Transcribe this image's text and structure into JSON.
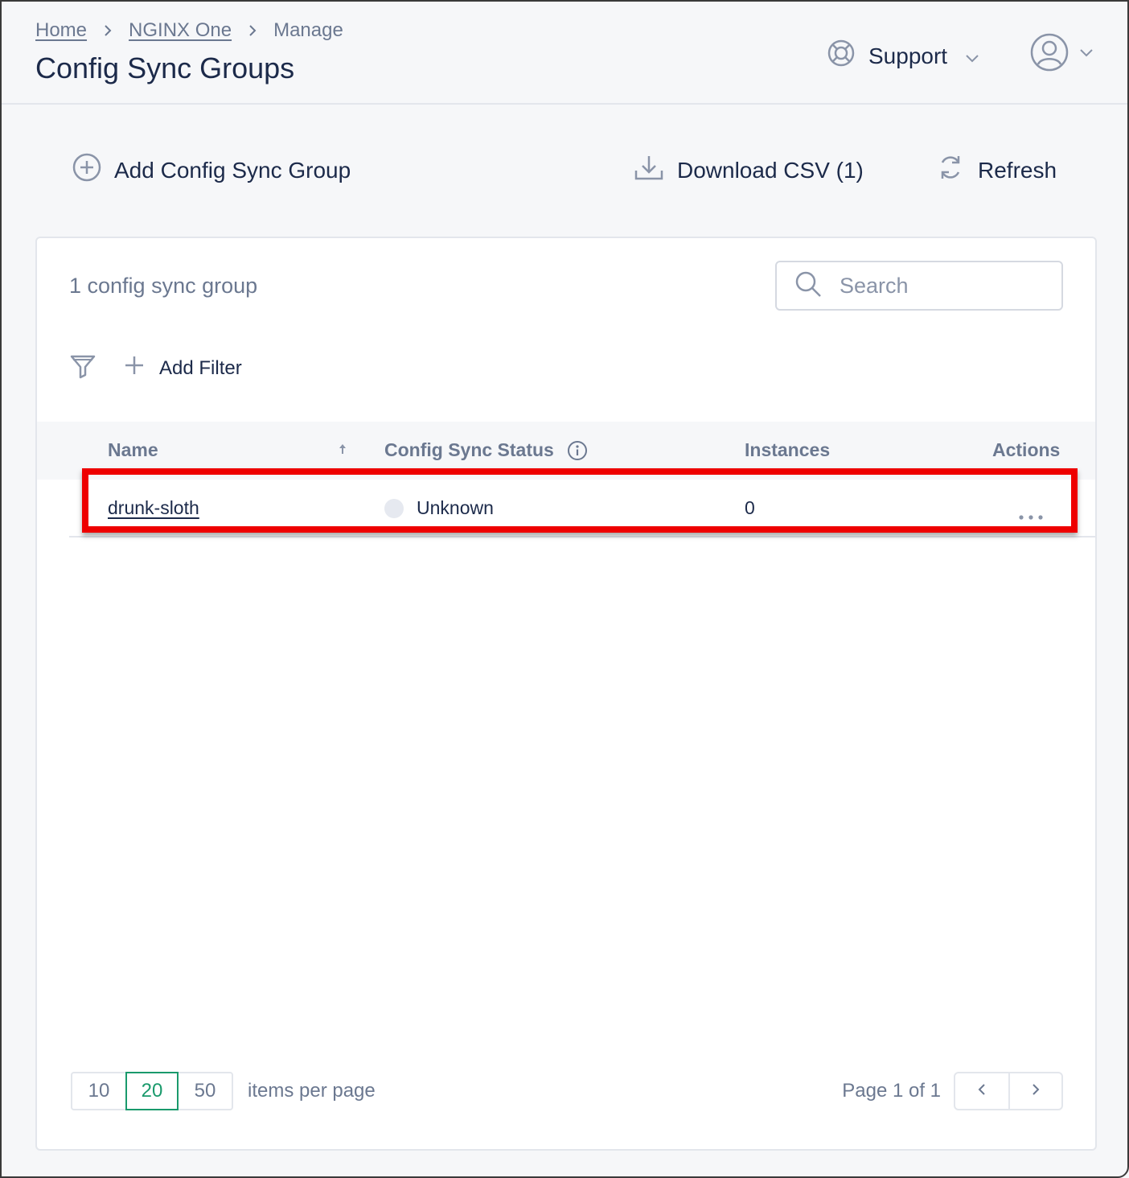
{
  "breadcrumb": {
    "items": [
      "Home",
      "NGINX One",
      "Manage"
    ]
  },
  "header": {
    "title": "Config Sync Groups",
    "support_label": "Support"
  },
  "toolbar": {
    "add_label": "Add Config Sync Group",
    "download_label": "Download CSV (1)",
    "refresh_label": "Refresh"
  },
  "list": {
    "count_text": "1 config sync group",
    "search_placeholder": "Search",
    "add_filter_label": "Add Filter",
    "columns": {
      "name": "Name",
      "status": "Config Sync Status",
      "instances": "Instances",
      "actions": "Actions"
    },
    "rows": [
      {
        "name": "drunk-sloth",
        "status": "Unknown",
        "instances": "0"
      }
    ]
  },
  "pagination": {
    "per_page_options": [
      "10",
      "20",
      "50"
    ],
    "selected_per_page": "20",
    "per_page_label": "items per page",
    "page_text": "Page 1 of 1"
  },
  "colors": {
    "accent_active": "#1a9a6c",
    "highlight": "#ee0000",
    "text_primary": "#1c2a4a",
    "text_muted": "#6b7890"
  }
}
